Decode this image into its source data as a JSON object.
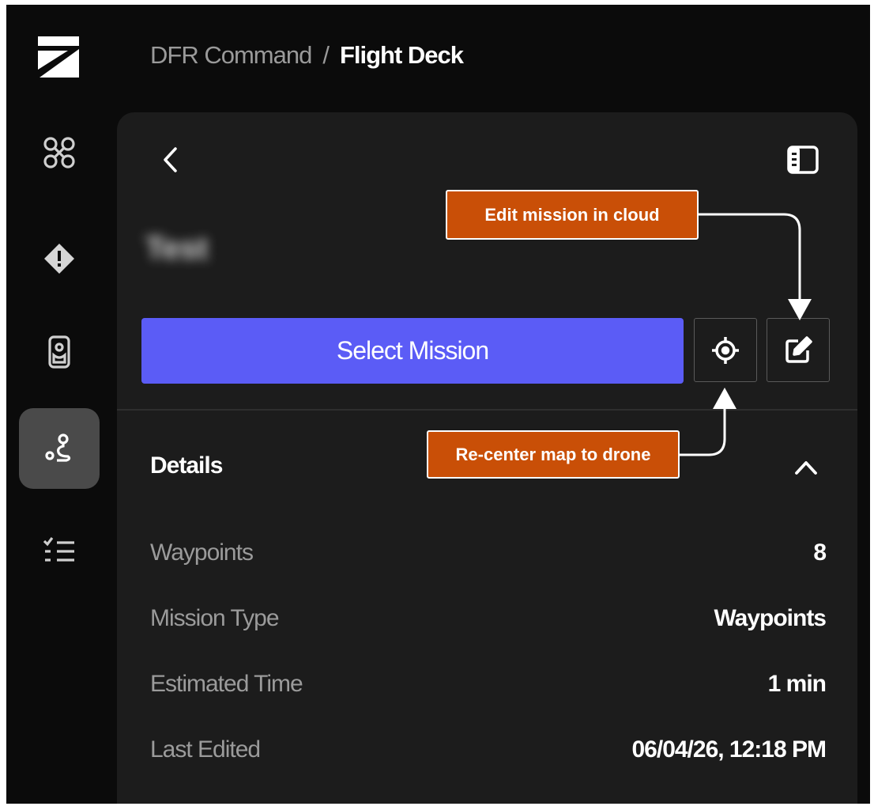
{
  "breadcrumb": {
    "root": "DFR Command",
    "separator": "/",
    "current": "Flight Deck"
  },
  "sidebar": {
    "items": [
      {
        "icon": "drone-icon",
        "active": false
      },
      {
        "icon": "alert-diamond-icon",
        "active": false
      },
      {
        "icon": "dock-icon",
        "active": false
      },
      {
        "icon": "route-icon",
        "active": true
      },
      {
        "icon": "checklist-icon",
        "active": false
      }
    ]
  },
  "panel": {
    "mission_name": "Test",
    "select_label": "Select Mission",
    "details_title": "Details",
    "details": [
      {
        "label": "Waypoints",
        "value": "8"
      },
      {
        "label": "Mission Type",
        "value": "Waypoints"
      },
      {
        "label": "Estimated Time",
        "value": "1 min"
      },
      {
        "label": "Last Edited",
        "value": "06/04/26, 12:18 PM"
      }
    ]
  },
  "annotations": {
    "edit": "Edit mission in cloud",
    "recenter": "Re-center map to drone"
  },
  "colors": {
    "background": "#0b0b0b",
    "panel": "#1c1c1c",
    "accent": "#5b5cf6",
    "callout": "#c94f07"
  }
}
